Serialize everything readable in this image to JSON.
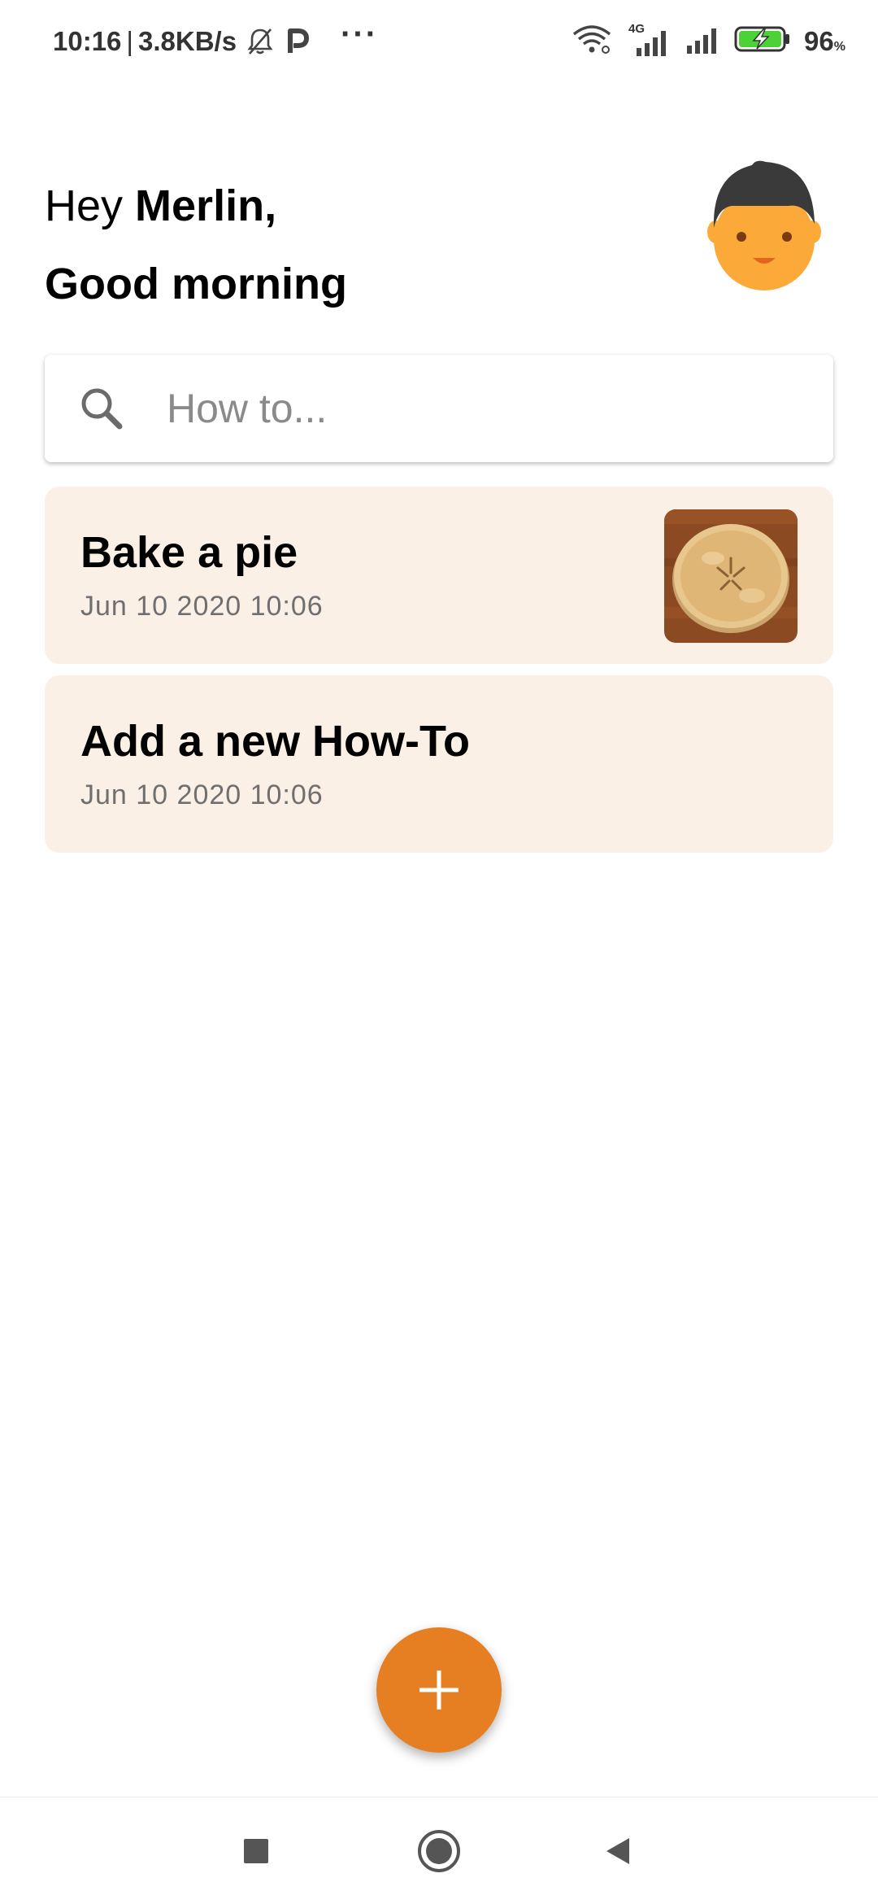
{
  "status_bar": {
    "time": "10:16",
    "separator": "|",
    "network_speed": "3.8KB/s",
    "overflow": "···",
    "network_type": "4G",
    "battery_level": "96",
    "battery_unit": "%"
  },
  "greeting": {
    "hey": "Hey ",
    "name": "Merlin,",
    "salutation": "Good morning"
  },
  "search": {
    "placeholder": "How to..."
  },
  "howtos": [
    {
      "title": "Bake a pie",
      "date": "Jun 10 2020 10:06",
      "has_image": true
    },
    {
      "title": "Add a new How-To",
      "date": "Jun 10 2020 10:06",
      "has_image": false
    }
  ],
  "colors": {
    "accent": "#e67e22",
    "card_bg": "#fbf0e6",
    "avatar_skin": "#fbaa3a",
    "avatar_hair": "#3a3a3a"
  }
}
